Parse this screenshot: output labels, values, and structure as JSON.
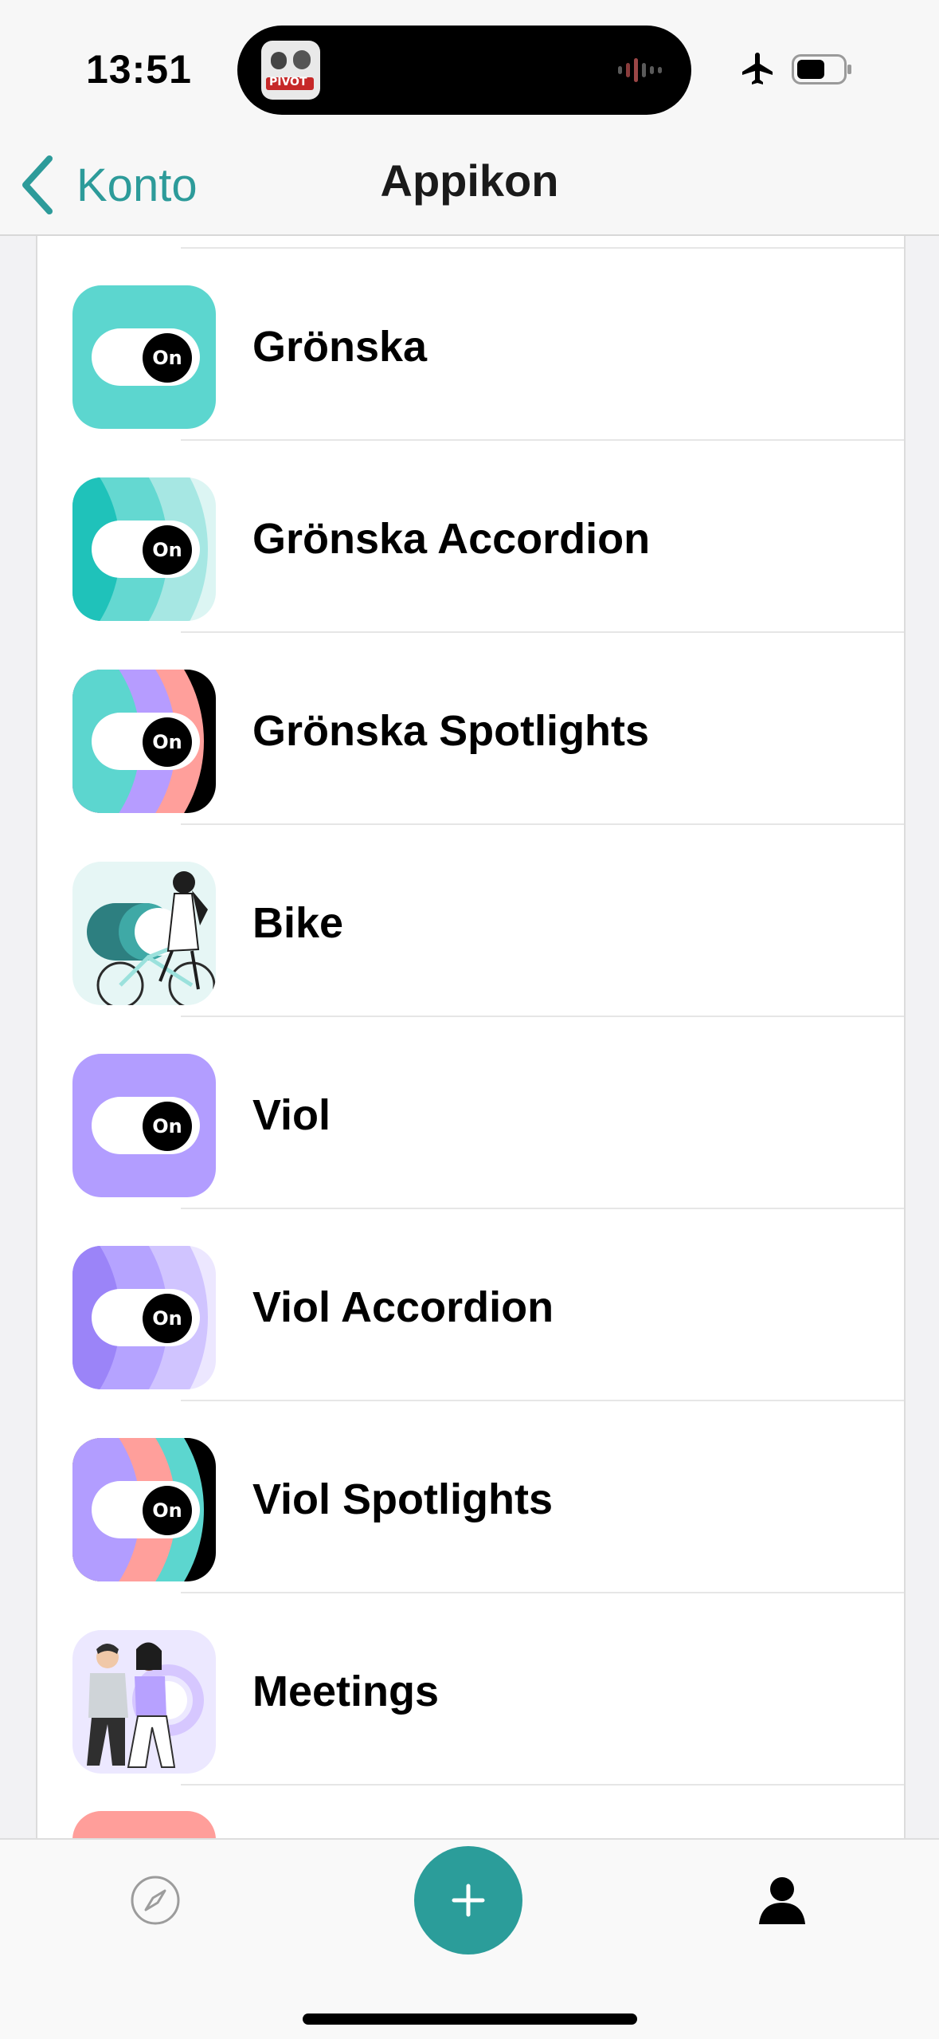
{
  "status_bar": {
    "time": "13:51",
    "island_art_text": "PIVOT"
  },
  "nav": {
    "back_label": "Konto",
    "title": "Appikon"
  },
  "toggle_text": "On",
  "icons": [
    {
      "label": "Grönska",
      "style": "flat",
      "colors": [
        "#5cd6cf"
      ]
    },
    {
      "label": "Grönska Accordion",
      "style": "accordion",
      "colors": [
        "#1fc2ba",
        "#64d8d1",
        "#a6e7e3",
        "#dcf5f3"
      ]
    },
    {
      "label": "Grönska Spotlights",
      "style": "spotlights",
      "colors": [
        "#5cd6cf",
        "#b69cff",
        "#ff9f9b",
        "#000000"
      ]
    },
    {
      "label": "Bike",
      "style": "illustration",
      "colors": [
        "#e6f6f5",
        "#2d7f80",
        "#3fa9a6",
        "#9be1dc"
      ]
    },
    {
      "label": "Viol",
      "style": "flat",
      "colors": [
        "#b29dff"
      ]
    },
    {
      "label": "Viol Accordion",
      "style": "accordion",
      "colors": [
        "#9b84f8",
        "#b5a3ff",
        "#d0c4ff",
        "#ece7ff"
      ]
    },
    {
      "label": "Viol Spotlights",
      "style": "spotlights",
      "colors": [
        "#b29dff",
        "#ff9f9b",
        "#5cd6cf",
        "#000000"
      ]
    },
    {
      "label": "Meetings",
      "style": "illustration-people",
      "colors": [
        "#ece8ff",
        "#b7a1ff",
        "#2f2f2f",
        "#d6c7ff"
      ]
    }
  ],
  "tab_bar": {
    "accent": "#2b9d9a",
    "items": [
      "compass-icon",
      "add-icon",
      "profile-icon"
    ]
  }
}
